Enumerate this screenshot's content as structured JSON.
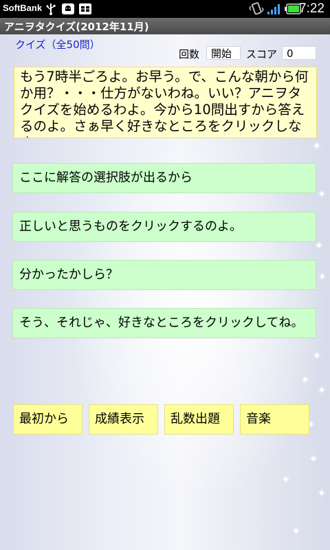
{
  "status_bar": {
    "carrier": "SoftBank",
    "time": "7:22",
    "icons": [
      "usb-icon",
      "android-debug-icon",
      "sim-icon",
      "vibrate-icon",
      "signal-icon",
      "battery-icon"
    ]
  },
  "title_bar": {
    "title": "アニヲタクイズ(2012年11月)"
  },
  "quiz_header": {
    "count_label": "クイズ（全50問）",
    "round_label": "回数",
    "round_value": "開始",
    "score_label": "スコア",
    "score_value": "0"
  },
  "message": {
    "text": "もう7時半ごろよ。お早う。で、こんな朝から何か用？・・・仕方がないわね。いい？アニヲタクイズを始めるわよ。今から10問出すから答えるのよ。さぁ早く好きなところをクリックしなさい。"
  },
  "choices": [
    {
      "label": "ここに解答の選択肢が出るから"
    },
    {
      "label": "正しいと思うものをクリックするのよ。"
    },
    {
      "label": "分かったかしら？"
    },
    {
      "label": "そう、それじゃ、好きなところをクリックしてね。"
    }
  ],
  "bottom_buttons": [
    {
      "label": "最初から"
    },
    {
      "label": "成績表示"
    },
    {
      "label": "乱数出題"
    },
    {
      "label": "音楽"
    }
  ],
  "colors": {
    "message_bg": "#ffffcc",
    "choice_bg": "#ccffcc",
    "button_bg": "#ffff99",
    "link_blue": "#1a23c8"
  }
}
